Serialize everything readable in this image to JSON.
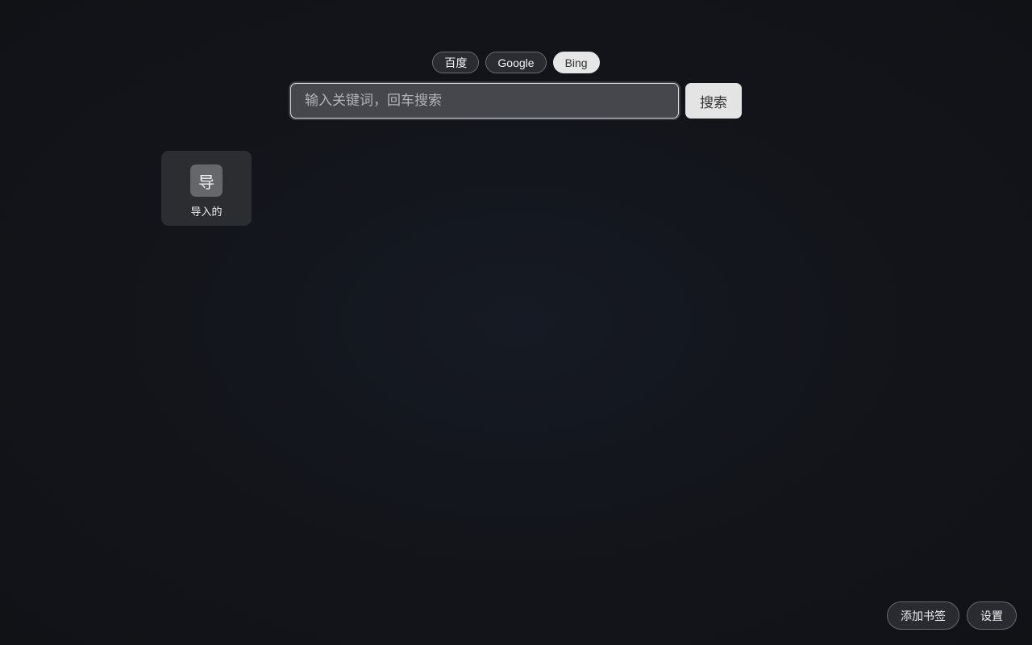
{
  "engines": [
    {
      "label": "百度",
      "active": false
    },
    {
      "label": "Google",
      "active": false
    },
    {
      "label": "Bing",
      "active": true
    }
  ],
  "search": {
    "placeholder": "输入关键词，回车搜索",
    "value": "",
    "button_label": "搜索"
  },
  "bookmarks": [
    {
      "icon_text": "导",
      "label": "导入的"
    }
  ],
  "actions": {
    "add_bookmark": "添加书签",
    "settings": "设置"
  }
}
